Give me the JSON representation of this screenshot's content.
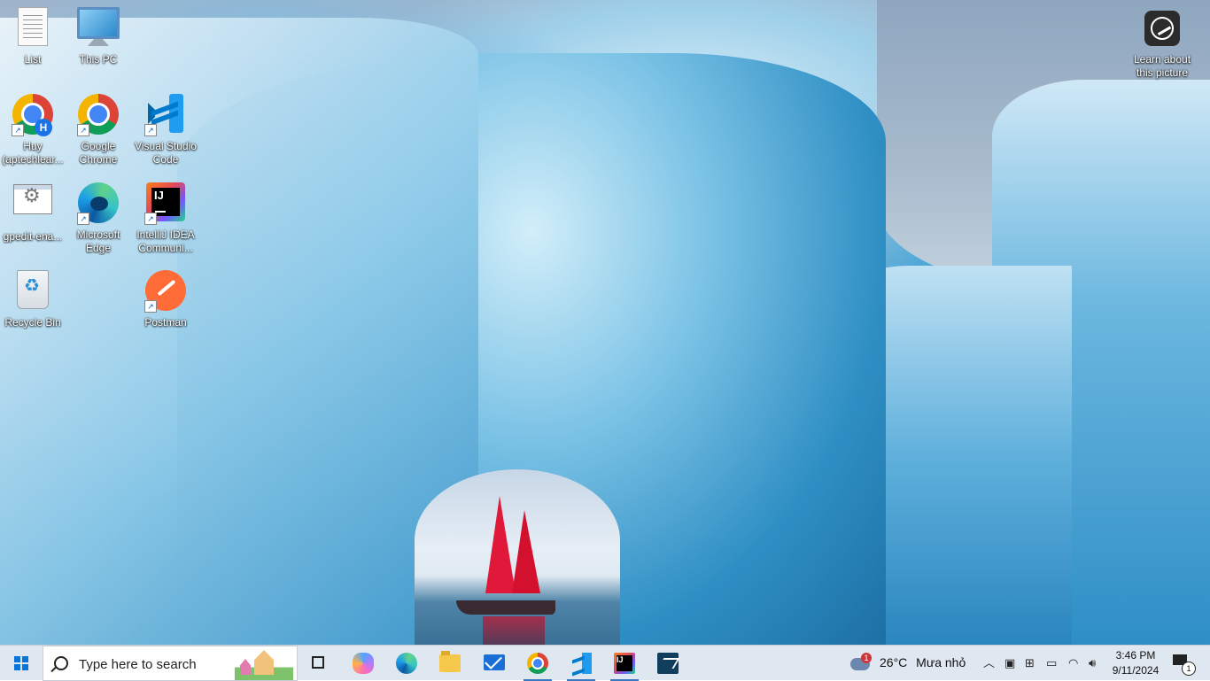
{
  "desktop": {
    "wallpaper": "iceberg-arch-with-red-sailboat",
    "icons": [
      {
        "label": "List",
        "icon": "text-document-icon"
      },
      {
        "label": "This PC",
        "icon": "computer-icon"
      },
      {
        "label": "Huy (aptechlear...",
        "icon": "chrome-profile-icon"
      },
      {
        "label": "Google Chrome",
        "icon": "chrome-icon"
      },
      {
        "label": "Visual Studio Code",
        "icon": "vscode-icon"
      },
      {
        "label": "gpedit-ena...",
        "icon": "batch-file-icon"
      },
      {
        "label": "Microsoft Edge",
        "icon": "edge-icon"
      },
      {
        "label": "IntelliJ IDEA Communi...",
        "icon": "intellij-icon"
      },
      {
        "label": "Recycle Bin",
        "icon": "recycle-bin-icon"
      },
      {
        "label": "Postman",
        "icon": "postman-icon"
      }
    ],
    "profile_badge": "H",
    "learn_about": {
      "label": "Learn about this picture",
      "icon": "camera-lens-icon"
    }
  },
  "taskbar": {
    "search_placeholder": "Type here to search",
    "pinned": [
      {
        "name": "task-view",
        "icon": "task-view-icon"
      },
      {
        "name": "copilot",
        "icon": "copilot-icon"
      },
      {
        "name": "edge",
        "icon": "edge-icon"
      },
      {
        "name": "file-explorer",
        "icon": "folder-icon"
      },
      {
        "name": "mail",
        "icon": "mail-icon"
      },
      {
        "name": "chrome",
        "icon": "chrome-icon"
      },
      {
        "name": "vscode",
        "icon": "vscode-icon"
      },
      {
        "name": "intellij",
        "icon": "intellij-icon"
      },
      {
        "name": "mysql-workbench",
        "icon": "mysql-workbench-icon"
      }
    ],
    "weather": {
      "badge": "1",
      "temperature": "26°C",
      "condition": "Mưa nhỏ"
    },
    "clock": {
      "time": "3:46 PM",
      "date": "9/11/2024"
    },
    "notifications": {
      "count": "1"
    }
  },
  "colors": {
    "taskbar_bg": "#dfe7f0",
    "accent": "#0a74d8",
    "sail": "#e0183a"
  }
}
